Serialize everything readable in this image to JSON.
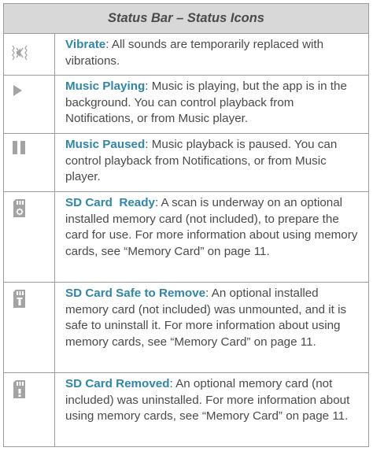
{
  "header": {
    "title": "Status Bar – Status Icons"
  },
  "colors": {
    "title_accent": "#2f86a8",
    "header_bg": "#d8d8d8",
    "icon_gray": "#a3a3a3",
    "border": "#9b9b9b"
  },
  "rows": [
    {
      "icon": "vibrate-icon",
      "title": "Vibrate",
      "text": ": All sounds are temporarily replaced with vibrations."
    },
    {
      "icon": "play-icon",
      "title": "Music Playing",
      "text": ": Music is playing, but the app is in the background. You can control playback from Notifications, or from Music player."
    },
    {
      "icon": "pause-icon",
      "title": "Music Paused",
      "text": ": Music playback is paused. You can control playback from Notifications, or from Music player."
    },
    {
      "icon": "sd-card-scan-icon",
      "title": "SD Card  Ready",
      "text": ": A scan is underway on an optional installed memory card (not included), to prepare the card for use. For more information about using memory cards, see “Memory Card” on page 11."
    },
    {
      "icon": "sd-card-remove-icon",
      "title": "SD Card Safe to Remove",
      "text": ": An optional installed memory card (not included) was unmounted, and it is safe to uninstall it. For more information about using memory cards, see “Memory Card” on page 11."
    },
    {
      "icon": "sd-card-removed-icon",
      "title": "SD Card Removed",
      "text": ": An optional memory card (not included) was uninstalled. For more information about using memory cards, see “Memory Card” on page 11."
    }
  ]
}
